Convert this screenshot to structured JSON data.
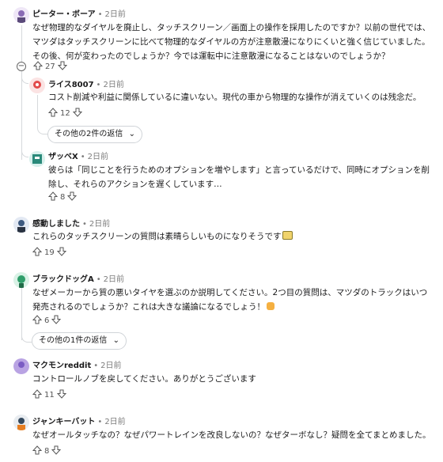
{
  "comments": [
    {
      "author": "ピーター・ボーア",
      "time": "2日前",
      "text": "なぜ物理的なダイヤルを廃止し、タッチスクリーン／画面上の操作を採用したのですか？以前の世代では、マツダはタッチスクリーンに比べて物理的なダイヤルの方が注意散漫になりにくいと強く信じていました。その後、何が変わったのでしょうか？今では運転中に注意散漫になることはないのでしょうか？",
      "votes": "27"
    },
    {
      "author": "ライス8007",
      "time": "2日前",
      "text": "コスト削減や利益に関係しているに違いない。現代の車から物理的な操作が消えていくのは残念だ。",
      "votes": "12",
      "more": "その他の2件の返信"
    },
    {
      "author": "ザッベX",
      "time": "2日前",
      "text": "彼らは「同じことを行うためのオプションを増やします」と言っているだけで、同時にオプションを削除し、それらのアクションを遅くしています…",
      "votes": "8"
    },
    {
      "author": "感動しました",
      "time": "2日前",
      "text": "これらのタッチスクリーンの質問は素晴らしいものになりそうです",
      "votes": "19"
    },
    {
      "author": "ブラックドッグA",
      "time": "2日前",
      "text": "なぜメーカーから質の悪いタイヤを選ぶのか説明してください。2つ目の質問は、マツダのトラックはいつ発売されるのでしょうか？これは大きな議論になるでしょう！",
      "votes": "6",
      "more": "その他の1件の返信"
    },
    {
      "author": "マクモンreddit",
      "time": "2日前",
      "text": "コントロールノブを戻してください。ありがとうございます",
      "votes": "11"
    },
    {
      "author": "ジャンキーバット",
      "time": "2日前",
      "text": "なぜオールタッチなの？なぜパワートレインを改良しないの？なぜターボなし？疑問を全てまとめました。",
      "votes": "8"
    }
  ],
  "colors": {
    "accent": "#0079d3",
    "meta": "#7c7c7c",
    "line": "#d6d9dc"
  },
  "icons": [
    "upvote-icon",
    "downvote-icon",
    "chevron-down-icon",
    "collapse-icon",
    "emoji-icon"
  ]
}
